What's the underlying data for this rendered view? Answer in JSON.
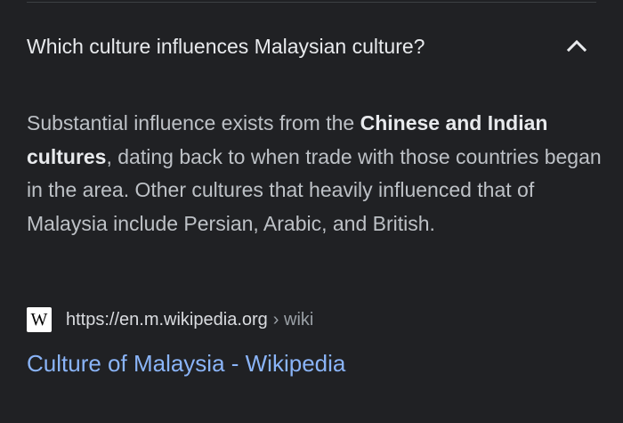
{
  "faq": {
    "question": "Which culture influences Malaysian culture?",
    "expanded_icon": "chevron-up-icon",
    "answer": {
      "part1": "Substantial influence exists from the ",
      "bold": "Chinese and Indian cultures",
      "part2": ", dating back to when trade with those countries began in the area. Other cultures that heavily influenced that of Malaysia include Persian, Arabic, and British."
    }
  },
  "source": {
    "favicon_letter": "W",
    "url": "https://en.m.wikipedia.org",
    "crumb": "› wiki",
    "title": "Culture of Malaysia - Wikipedia"
  },
  "colors": {
    "background": "#202124",
    "question_text": "#e8eaed",
    "answer_text": "#bdc1c6",
    "link": "#8ab4f8"
  }
}
